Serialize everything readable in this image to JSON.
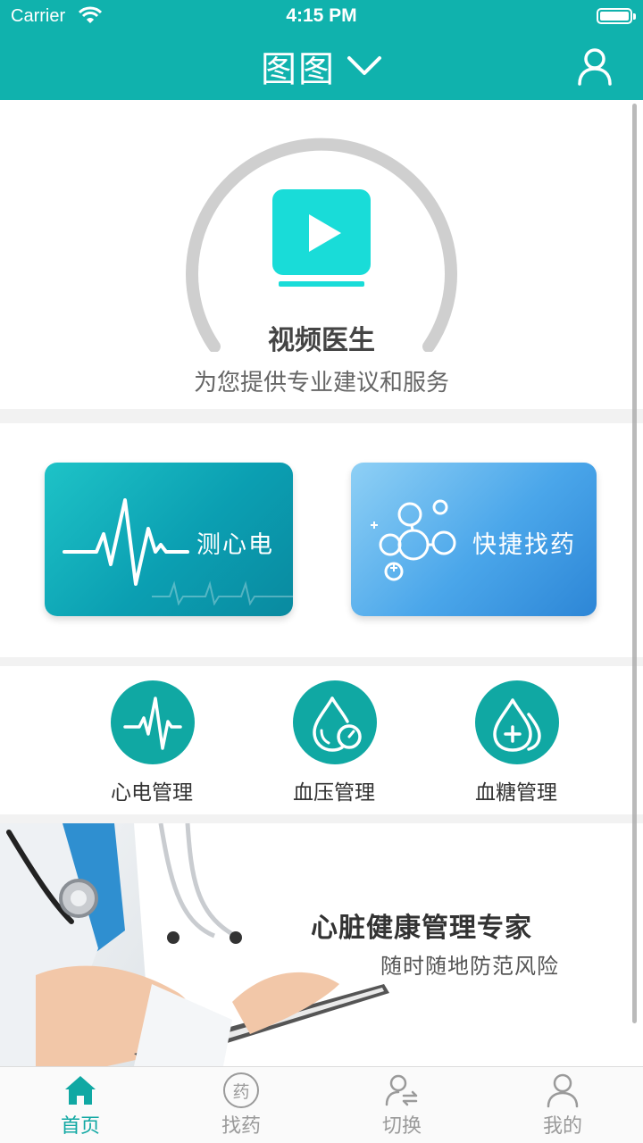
{
  "status_bar": {
    "carrier": "Carrier",
    "time": "4:15 PM"
  },
  "nav": {
    "title": "图图"
  },
  "video_doctor": {
    "title": "视频医生",
    "subtitle": "为您提供专业建议和服务"
  },
  "cards": {
    "ecg_label": "测心电",
    "medicine_label": "快捷找药"
  },
  "management": {
    "items": [
      {
        "label": "心电管理",
        "icon": "ecg-icon"
      },
      {
        "label": "血压管理",
        "icon": "blood-pressure-icon"
      },
      {
        "label": "血糖管理",
        "icon": "blood-sugar-icon"
      }
    ]
  },
  "banner": {
    "title": "心脏健康管理专家",
    "subtitle": "随时随地防范风险"
  },
  "tabbar": {
    "tabs": [
      {
        "label": "首页",
        "icon": "home-icon",
        "active": true
      },
      {
        "label": "找药",
        "icon": "medicine-icon",
        "icon_text": "药",
        "active": false
      },
      {
        "label": "切换",
        "icon": "switch-user-icon",
        "active": false
      },
      {
        "label": "我的",
        "icon": "profile-icon",
        "active": false
      }
    ]
  },
  "colors": {
    "primary": "#10b2ad",
    "icon_bg": "#10a8a3",
    "play": "#19dcd8",
    "arc": "#cfcfcf",
    "tab_inactive": "#9a9a9a"
  }
}
